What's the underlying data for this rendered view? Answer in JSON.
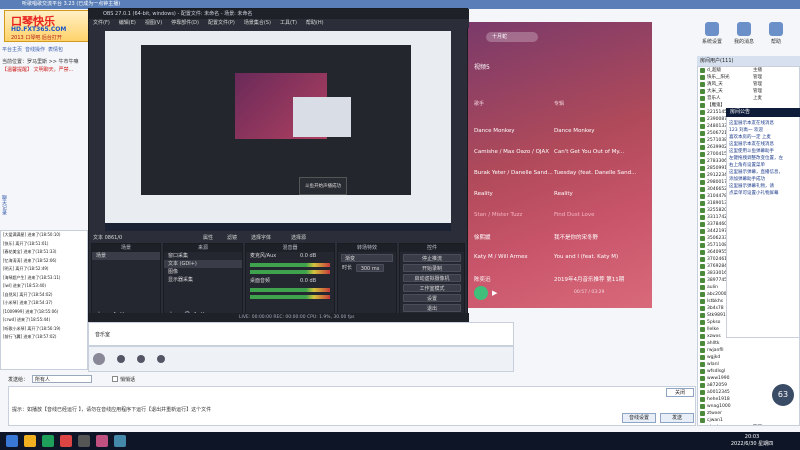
{
  "host": {
    "title": "听歌唱歌交流平台 3.23 (已成为一点钟主播)",
    "logo": {
      "line1": "口琴快乐",
      "line2": "HD.FXT365.COM",
      "line3": "2013 口琴吧 后台打开"
    },
    "nav": [
      "平台主页",
      "音线操作",
      "表情包"
    ],
    "announce_user": "当前位置：罗马里斯 >> 牛市牛嘛",
    "announce_warning": "【温馨提醒】 文明聊天，严禁...",
    "side_vtext": "聊天记录",
    "log_lines": [
      "[大爱满满星] 进来了(18:50:10)",
      "[快乐] 离开了(18:51:01)",
      "[春花美宝] 进来了(18:51:33)",
      "[忆海涛涛] 进来了(18:52:06)",
      "[明天] 离开了(18:52:49)",
      "[海琴超产生] 进来了(18:53:11)",
      "[lwl] 进来了(18:53:40)",
      "[自然风] 离开了(18:54:02)",
      "[小米琴] 进来了(18:54:37)",
      "[1009999] 进来了(18:55:06)",
      "[crwd] 进来了(18:55:44)",
      "[听歌小米琴] 离开了(18:56:19)",
      "[前行飞翼] 进来了(18:57:02)"
    ],
    "send_to_label": "发送给：",
    "send_to_value": "所有人",
    "private_label": "悄悄话",
    "tip": "提示：如播放【音线已经运行 】，请勿在音线应用程序下运行【退出并重新运行】这个文件",
    "settings_button": "音线设置",
    "send_button": "发送",
    "close_button": "关闭",
    "tools": [
      "系统设置",
      "我的消息",
      "帮助"
    ],
    "userlist_head": "房间用户(111)",
    "users": [
      {
        "name": "d_超级",
        "role": "主播"
      },
      {
        "name": "快乐__阳光",
        "role": "管理"
      },
      {
        "name": "清风_天",
        "role": "管理"
      },
      {
        "name": "大米_天",
        "role": "管理"
      },
      {
        "name": "音乐人",
        "role": "上麦"
      },
      {
        "name": "【魔鬼】",
        "role": ""
      },
      {
        "name": "2215145",
        "role": ""
      },
      {
        "name": "2390087",
        "role": ""
      },
      {
        "name": "2480133",
        "role": ""
      },
      {
        "name": "2506721",
        "role": ""
      },
      {
        "name": "2571038",
        "role": ""
      },
      {
        "name": "2639902",
        "role": ""
      },
      {
        "name": "2700415",
        "role": ""
      },
      {
        "name": "2783306",
        "role": ""
      },
      {
        "name": "2850991",
        "role": ""
      },
      {
        "name": "2912234",
        "role": ""
      },
      {
        "name": "2980017",
        "role": ""
      },
      {
        "name": "3046652",
        "role": ""
      },
      {
        "name": "3104478",
        "role": ""
      },
      {
        "name": "3189013",
        "role": ""
      },
      {
        "name": "3255820",
        "role": ""
      },
      {
        "name": "3311742",
        "role": ""
      },
      {
        "name": "3378460",
        "role": ""
      },
      {
        "name": "3442197",
        "role": ""
      },
      {
        "name": "3506233",
        "role": ""
      },
      {
        "name": "3571108",
        "role": ""
      },
      {
        "name": "3640955",
        "role": ""
      },
      {
        "name": "3702461",
        "role": ""
      },
      {
        "name": "3769284",
        "role": ""
      },
      {
        "name": "3833016",
        "role": ""
      },
      {
        "name": "3897745",
        "role": ""
      },
      {
        "name": "aulin",
        "role": ""
      },
      {
        "name": "abc2000",
        "role": ""
      },
      {
        "name": "lstbkhs",
        "role": ""
      },
      {
        "name": "3b4s78",
        "role": ""
      },
      {
        "name": "Stk9891",
        "role": ""
      },
      {
        "name": "5pkso",
        "role": ""
      },
      {
        "name": "llelke",
        "role": ""
      },
      {
        "name": "xzwxs",
        "role": ""
      },
      {
        "name": "ahlltk",
        "role": ""
      },
      {
        "name": "rwjanfll",
        "role": ""
      },
      {
        "name": "wgjkd",
        "role": ""
      },
      {
        "name": "wlanl",
        "role": ""
      },
      {
        "name": "wfsdlsgl",
        "role": ""
      },
      {
        "name": "www1990",
        "role": ""
      },
      {
        "name": "a872059",
        "role": ""
      },
      {
        "name": "a0012345",
        "role": ""
      },
      {
        "name": "hehe1918",
        "role": ""
      },
      {
        "name": "wnag1000",
        "role": ""
      },
      {
        "name": "ztwxer",
        "role": ""
      },
      {
        "name": "cjwan1",
        "role": ""
      },
      {
        "name": "pingke",
        "role": "管理"
      },
      {
        "name": "zjhvd",
        "role": "上麦"
      },
      {
        "name": "tzkjer",
        "role": "上麦"
      },
      {
        "name": "xdcfw",
        "role": "管理"
      }
    ],
    "notice_head": "房间公告",
    "notice_lines": [
      "这里展示本友在线消息",
      "123 刘禹一 欢迎",
      "喜欢本房的一定 上麦",
      "",
      "这里展示本友在线消息",
      "这里使用斗鱼弹幕助手",
      "左键拖拽调整改变位置，左",
      "右上角有设置菜单",
      "这里展示弹幕，直播信息，",
      "添加弹幕助手成功",
      "",
      "",
      "",
      "",
      "",
      "这里展示弹幕礼物，请",
      "点菜单可设置小礼物屏幕"
    ],
    "badge_count": "63"
  },
  "music": {
    "search_placeholder": "十月蛇",
    "header": "视频5",
    "col_artist": "歌手",
    "col_song": "专辑",
    "rows": [
      {
        "artist": "Dance Monkey",
        "song": "Dance Monkey",
        "faded": false
      },
      {
        "artist": "Camishe / Max Oazo / OJAX",
        "song": "Can't Get You Out of My...",
        "faded": false
      },
      {
        "artist": "Burak Yeter / Danelle Sand...",
        "song": "Tuesday (feat. Danelle Sand...",
        "faded": false
      },
      {
        "artist": "Reality",
        "song": "Reality",
        "faded": false
      },
      {
        "artist": "Stan / Mister Tuzz",
        "song": "Find Dust Love",
        "faded": true
      },
      {
        "artist": "徐熙媛",
        "song": "我不是你的宋冬野",
        "faded": false
      },
      {
        "artist": "Katy M / Will Armex",
        "song": "You and I (feat. Katy M)",
        "faded": false
      },
      {
        "artist": "陈奕迅",
        "song": "2019年4月音乐推荐 第11期",
        "faded": false
      }
    ],
    "time": "00:57 / 03:29"
  },
  "obs": {
    "title": "OBS 27.0.1 (64-bit, windows) - 配置文件: 未命名 - 场景: 未命名",
    "menu": [
      "文件(F)",
      "编辑(E)",
      "视图(V)",
      "停靠部件(D)",
      "配置文件(P)",
      "场景集合(S)",
      "工具(T)",
      "帮助(H)"
    ],
    "popup_label": "斗鱼开始声播成功",
    "toolbar_items": [
      "文本",
      "属性",
      "滤镜",
      "选择字体",
      "选择源"
    ],
    "toolbar_label": "文本  0861/0",
    "scenes_head": "场景",
    "scenes": [
      "场景"
    ],
    "sources_head": "来源",
    "sources": [
      "窗口采集",
      "文本 (GDI+)",
      "图像",
      "显示器采集"
    ],
    "mixer_head": "混音器",
    "mixer": [
      {
        "name": "麦克风/Aux",
        "level": "0.0 dB"
      },
      {
        "name": "桌面音频",
        "level": "0.0 dB"
      }
    ],
    "trans_head": "转场特效",
    "trans_type": "渐变",
    "trans_duration_label": "时长",
    "trans_duration": "300 ms",
    "controls_head": "控件",
    "controls": [
      "停止推流",
      "开始录制",
      "启动虚拟摄像机",
      "工作室模式",
      "设置",
      "退出"
    ],
    "status": "LIVE: 00:00:00   REC: 00:00:00   CPU: 1.9%, 30.00 fps",
    "below_name": "音乐室"
  },
  "taskbar": {
    "time": "20:03",
    "date": "2022/6/30 星期四"
  },
  "colors": {
    "obs_bg": "#2b2e38",
    "music_gradient_start": "#7a3a6a",
    "music_gradient_end": "#d96a7a",
    "play_green": "#3fbf7a",
    "host_accent": "#3a5db0"
  }
}
